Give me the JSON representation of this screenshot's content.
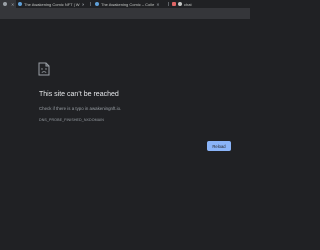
{
  "tabs": [
    {
      "label": "",
      "icon": "globe-icon"
    },
    {
      "label": "The Awakening Comic NFT | W",
      "icon": "site-icon"
    },
    {
      "label": "The Awakening Comic – Colle",
      "icon": "site-icon"
    },
    {
      "label": "chat",
      "icon": "chat-icon"
    }
  ],
  "error": {
    "title": "This site can’t be reached",
    "description": "Check if there is a typo in awakeningnft.io.",
    "code": "DNS_PROBE_FINISHED_NXDOMAIN",
    "reload_label": "Reload"
  },
  "colors": {
    "background": "#202124",
    "accent": "#8ab4f8"
  }
}
